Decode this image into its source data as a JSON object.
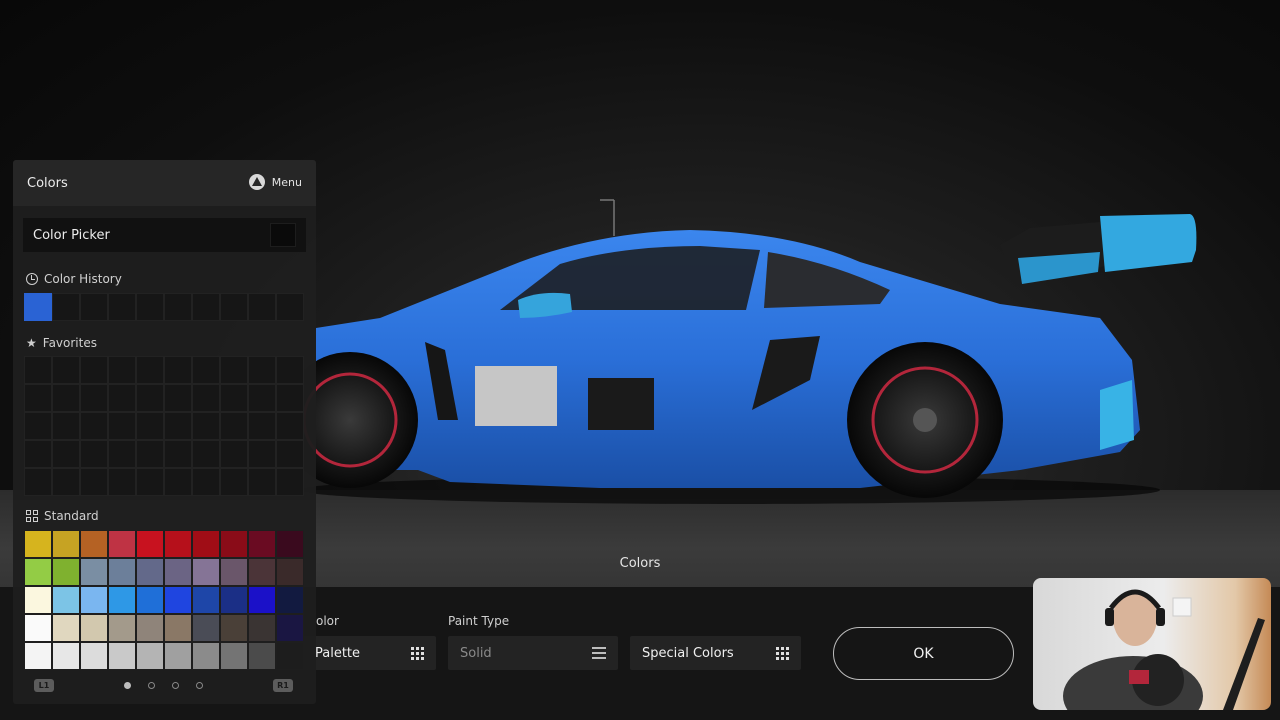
{
  "panel": {
    "title": "Colors",
    "menu_label": "Menu",
    "picker_label": "Color Picker",
    "history_label": "Color History",
    "favorites_label": "Favorites",
    "standard_label": "Standard",
    "history_colors": [
      "#2a63d4"
    ],
    "standard_colors": [
      "#d6b41e",
      "#c6a323",
      "#b56224",
      "#bf3344",
      "#c8121f",
      "#b6101b",
      "#a00d16",
      "#8a0c18",
      "#6a0b22",
      "#3a0a1e",
      "#93cc45",
      "#7fb12f",
      "#7a8ea3",
      "#6c7f9a",
      "#63698a",
      "#6b6484",
      "#857496",
      "#6a566a",
      "#4b3438",
      "#3a2a2a",
      "#fbf7df",
      "#7cc4e6",
      "#7ab6f0",
      "#2e98e6",
      "#1f6fd8",
      "#1f45e0",
      "#1e46a8",
      "#1b2f86",
      "#1b11c8",
      "#121a40",
      "#fafafa",
      "#e0d7bf",
      "#d2c8ae",
      "#a39a8b",
      "#8f847a",
      "#8a7866",
      "#4a4c56",
      "#4a4038",
      "#3a3433",
      "#1a1642",
      "#f4f4f4",
      "#e7e7e7",
      "#dcdcdc",
      "#c9c9c9",
      "#b4b4b4",
      "#a0a0a0",
      "#8b8b8b",
      "#747474",
      "#4b4b4b",
      "#1d1d1d"
    ],
    "l1": "L1",
    "r1": "R1"
  },
  "stage": {
    "caption": "Colors",
    "car_color": "#2a6fd8"
  },
  "bottom": {
    "field1_label": "olor",
    "field1_value": "Palette",
    "paint_type_label": "Paint Type",
    "paint_type_value": "Solid",
    "special_value": "Special Colors",
    "ok_label": "OK"
  }
}
